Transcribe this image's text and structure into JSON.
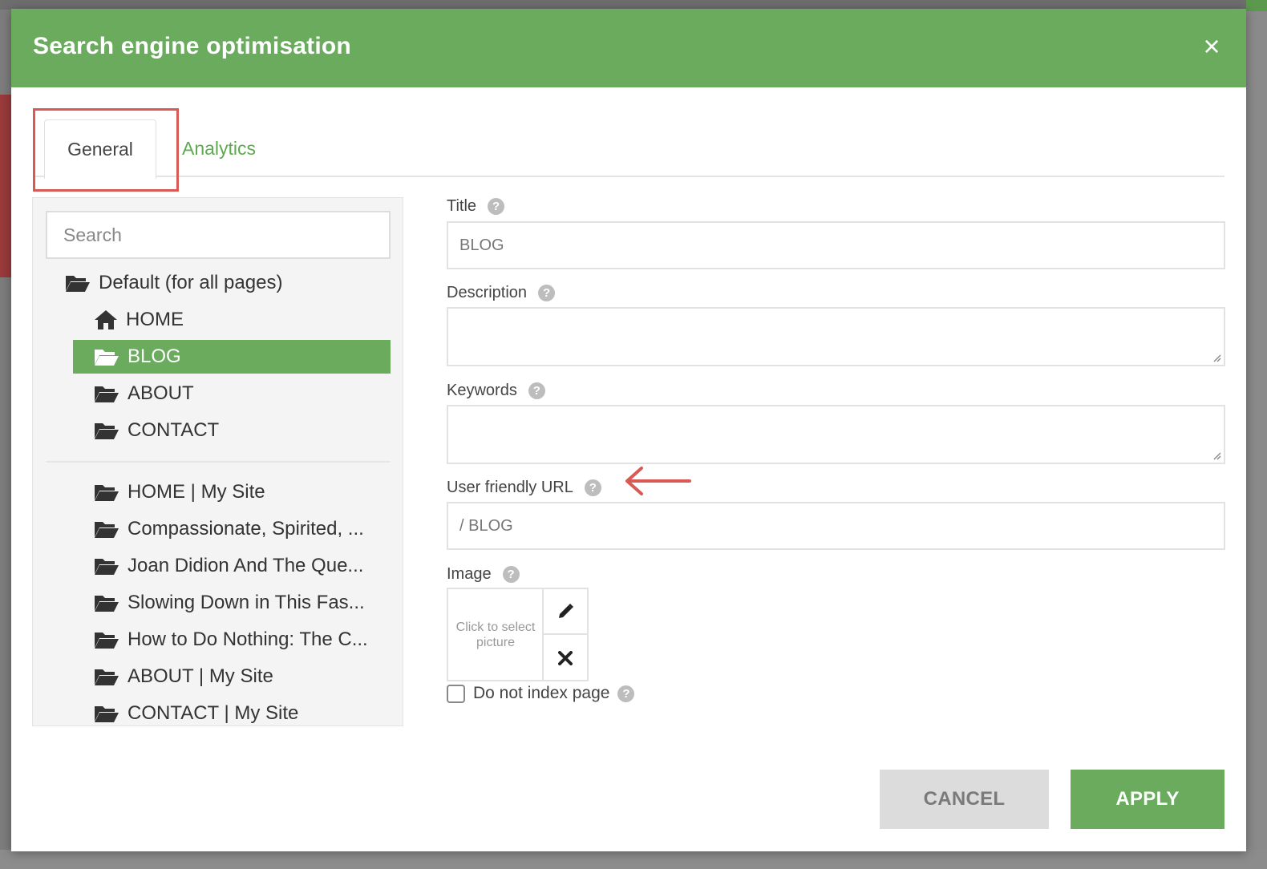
{
  "dialog": {
    "title": "Search engine optimisation",
    "close_symbol": "×"
  },
  "tabs": [
    {
      "label": "General",
      "active": true
    },
    {
      "label": "Analytics",
      "active": false
    }
  ],
  "tree": {
    "search_placeholder": "Search",
    "items": [
      {
        "label": "Default (for all pages)",
        "icon": "folder-open-icon"
      },
      {
        "label": "HOME",
        "icon": "home-icon"
      },
      {
        "label": "BLOG",
        "icon": "folder-open-icon",
        "selected": true
      },
      {
        "label": "ABOUT",
        "icon": "folder-open-icon"
      },
      {
        "label": "CONTACT",
        "icon": "folder-open-icon"
      }
    ],
    "pages": [
      {
        "label": "HOME | My Site",
        "icon": "folder-open-icon"
      },
      {
        "label": "Compassionate, Spirited, ...",
        "icon": "folder-open-icon"
      },
      {
        "label": "Joan Didion And The Que...",
        "icon": "folder-open-icon"
      },
      {
        "label": "Slowing Down in This Fas...",
        "icon": "folder-open-icon"
      },
      {
        "label": "How to Do Nothing: The C...",
        "icon": "folder-open-icon"
      },
      {
        "label": "ABOUT | My Site",
        "icon": "folder-open-icon"
      },
      {
        "label": "CONTACT | My Site",
        "icon": "folder-open-icon"
      }
    ]
  },
  "form": {
    "title": {
      "label": "Title",
      "value": "BLOG"
    },
    "description": {
      "label": "Description",
      "value": ""
    },
    "keywords": {
      "label": "Keywords",
      "value": ""
    },
    "url": {
      "label": "User friendly URL",
      "value": "/ BLOG"
    },
    "image": {
      "label": "Image",
      "placeholder": "Click to select picture"
    },
    "noindex": {
      "label": "Do not index page",
      "checked": false
    }
  },
  "buttons": {
    "cancel": "CANCEL",
    "apply": "APPLY"
  },
  "colors": {
    "brand_green": "#6aab5e",
    "annotation_red": "#d95a55"
  }
}
